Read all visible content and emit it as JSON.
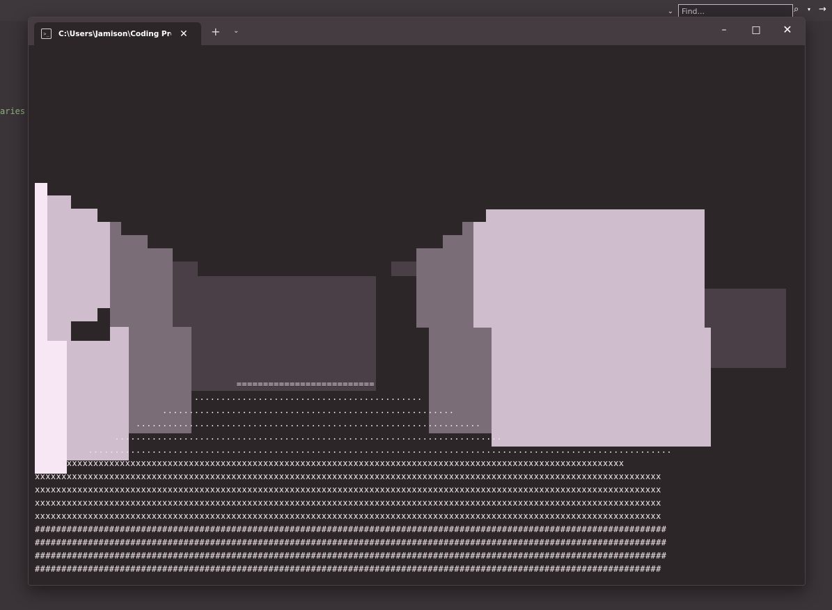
{
  "ide": {
    "side_text": "aries",
    "find_placeholder": "Find...",
    "find_icon": "search-icon",
    "find_dropdown_icon": "chevron-down-icon",
    "find_next_icon": "arrow-right-icon"
  },
  "window": {
    "tab_title": "C:\\Users\\Jamison\\Coding Pro",
    "tab_icon": "terminal-icon",
    "tab_close_icon": "close-icon",
    "new_tab_label": "+",
    "tab_menu_icon": "chevron-down-icon",
    "minimize_label": "–",
    "maximize_label": "□",
    "close_label": "✕"
  },
  "render": {
    "colors": {
      "sky": "#2d2629",
      "wall_far": "#4a3f46",
      "wall_mid": "#7b6d78",
      "wall_near": "#cfbccc",
      "wall_closest": "#f7e6f4",
      "floor_text": "#efe4ea"
    },
    "floor_rows": [
      "                                      ==========================",
      "                              ...........................................",
      "                        .......................................................",
      "                   .................................................................",
      "               .........................................................................",
      "          ..............................................................................................................",
      "     xxxxxxxxxxxxxxxxxxxxxxxxxxxxxxxxxxxxxxxxxxxxxxxxxxxxxxxxxxxxxxxxxxxxxxxxxxxxxxxxxxxxxxxxxxxxxxxxxxxxxxxxxx",
      "xxxxxxxxxxxxxxxxxxxxxxxxxxxxxxxxxxxxxxxxxxxxxxxxxxxxxxxxxxxxxxxxxxxxxxxxxxxxxxxxxxxxxxxxxxxxxxxxxxxxxxxxxxxxxxxxxxxxxx",
      "xxxxxxxxxxxxxxxxxxxxxxxxxxxxxxxxxxxxxxxxxxxxxxxxxxxxxxxxxxxxxxxxxxxxxxxxxxxxxxxxxxxxxxxxxxxxxxxxxxxxxxxxxxxxxxxxxxxxxx",
      "xxxxxxxxxxxxxxxxxxxxxxxxxxxxxxxxxxxxxxxxxxxxxxxxxxxxxxxxxxxxxxxxxxxxxxxxxxxxxxxxxxxxxxxxxxxxxxxxxxxxxxxxxxxxxxxxxxxxxx",
      "xxxxxxxxxxxxxxxxxxxxxxxxxxxxxxxxxxxxxxxxxxxxxxxxxxxxxxxxxxxxxxxxxxxxxxxxxxxxxxxxxxxxxxxxxxxxxxxxxxxxxxxxxxxxxxxxxxxxxx",
      "#######################################################################################################################",
      "#######################################################################################################################",
      "#######################################################################################################################",
      "######################################################################################################################"
    ]
  }
}
